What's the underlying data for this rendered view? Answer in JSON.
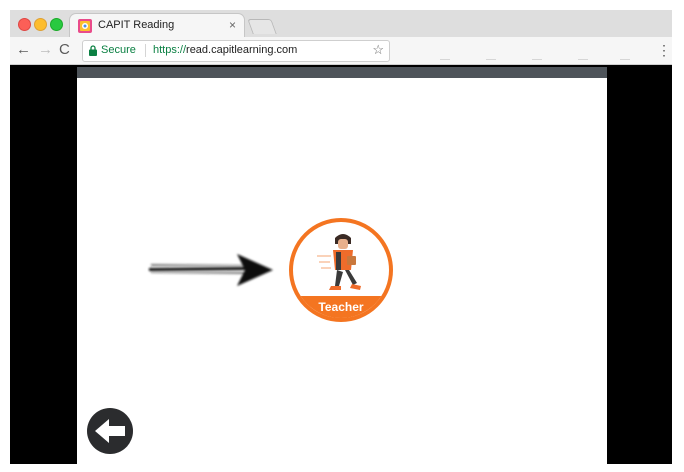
{
  "browser": {
    "tab_title": "CAPIT Reading",
    "tab_close": "×",
    "secure_label": "Secure",
    "url_scheme": "https://",
    "url_host": "read.capitlearning.com",
    "back_glyph": "←",
    "forward_glyph": "→",
    "reload_glyph": "C",
    "star_glyph": "☆",
    "menu_glyph": "⋮",
    "icons": [
      "back-icon",
      "forward-icon",
      "reload-icon",
      "lock-icon",
      "star-icon",
      "menu-icon"
    ]
  },
  "app": {
    "teacher_label": "Teacher",
    "colors": {
      "accent": "#f47521",
      "bar": "#4e545a",
      "back_button": "#2b2c2e"
    }
  }
}
